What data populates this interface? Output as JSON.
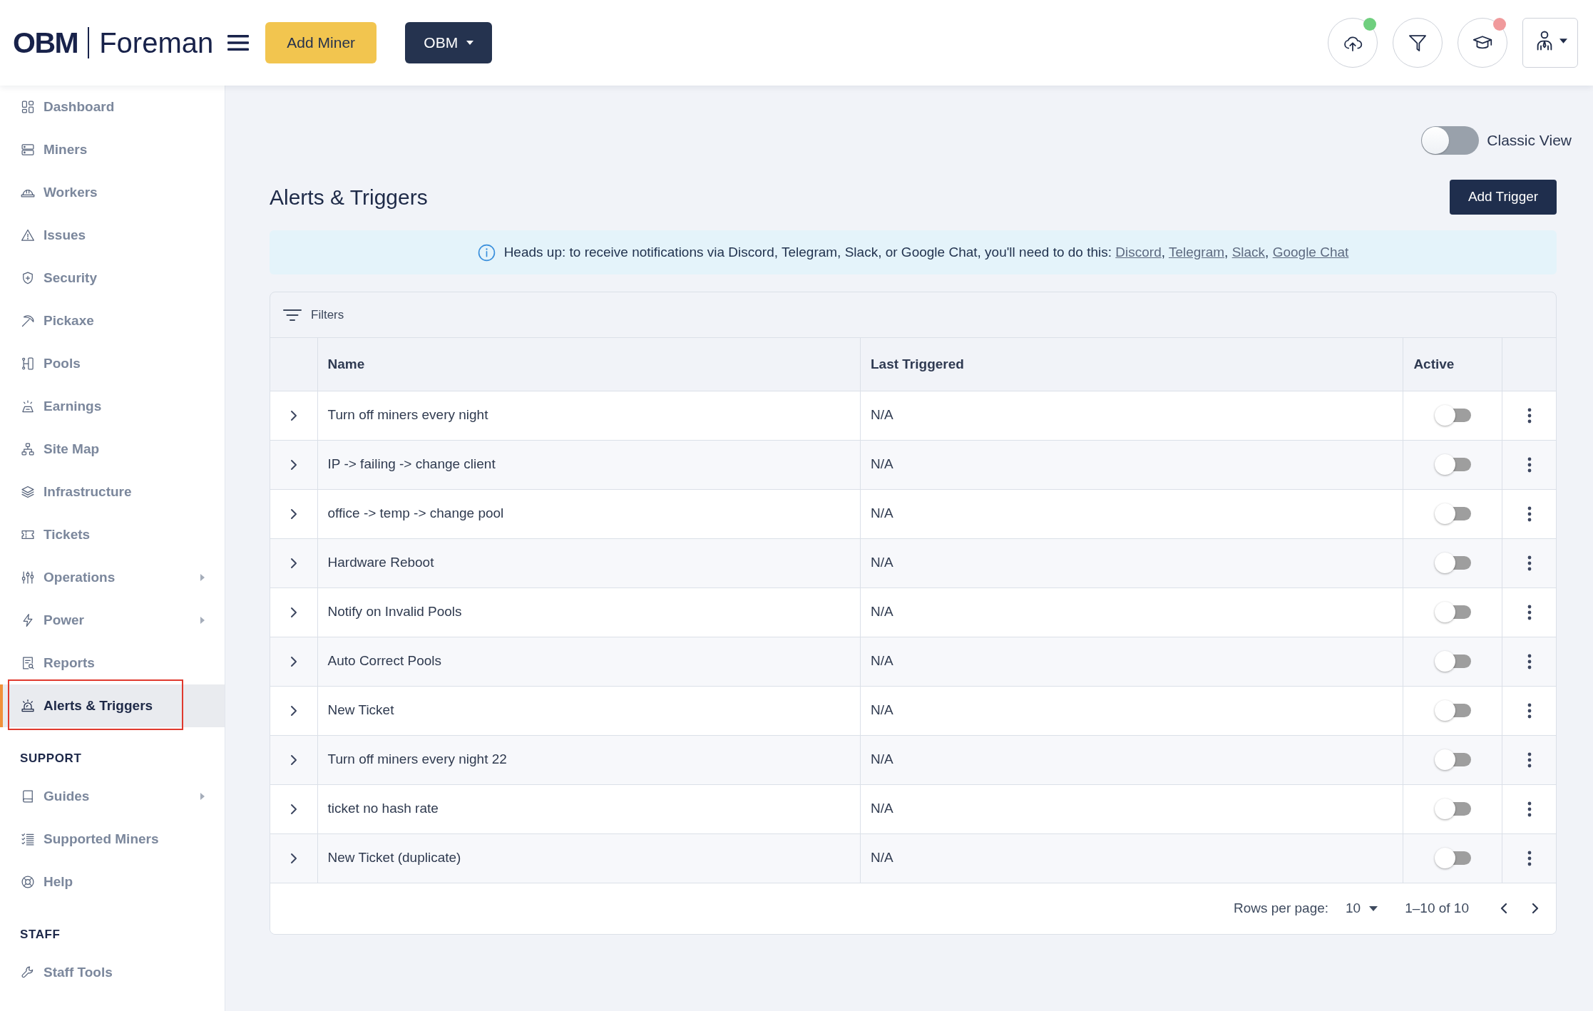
{
  "header": {
    "logo": {
      "brand": "OBM",
      "product": "Foreman"
    },
    "add_button": "Add Miner",
    "org_menu": "OBM",
    "icons": [
      {
        "kind": "round",
        "color": "#6fcf7e"
      },
      {
        "kind": "round"
      },
      {
        "kind": "round",
        "color": "#f09a9c"
      },
      {
        "kind": "square"
      }
    ]
  },
  "sidebar": {
    "sections": [
      {
        "items": [
          {
            "label": "Dashboard",
            "selected": false,
            "expandable": false,
            "highlighted": false
          },
          {
            "label": "Miners",
            "selected": false,
            "expandable": false,
            "highlighted": false
          },
          {
            "label": "Workers",
            "selected": false,
            "expandable": false,
            "highlighted": false
          },
          {
            "label": "Issues",
            "selected": false,
            "expandable": false,
            "highlighted": false
          },
          {
            "label": "Security",
            "selected": false,
            "expandable": false,
            "highlighted": false
          },
          {
            "label": "Pickaxe",
            "selected": false,
            "expandable": false,
            "highlighted": false
          },
          {
            "label": "Pools",
            "selected": false,
            "expandable": false,
            "highlighted": false
          },
          {
            "label": "Earnings",
            "selected": false,
            "expandable": false,
            "highlighted": false
          },
          {
            "label": "Site Map",
            "selected": false,
            "expandable": false,
            "highlighted": false
          },
          {
            "label": "Infrastructure",
            "selected": false,
            "expandable": false,
            "highlighted": false
          },
          {
            "label": "Tickets",
            "selected": false,
            "expandable": false,
            "highlighted": false
          },
          {
            "label": "Operations",
            "selected": false,
            "expandable": true,
            "highlighted": false
          },
          {
            "label": "Power",
            "selected": false,
            "expandable": true,
            "highlighted": false
          },
          {
            "label": "Reports",
            "selected": false,
            "expandable": false,
            "highlighted": false
          },
          {
            "label": "Alerts & Triggers",
            "selected": true,
            "expandable": false,
            "highlighted": true
          }
        ]
      },
      {
        "title": "SUPPORT",
        "items": [
          {
            "label": "Guides",
            "selected": false,
            "expandable": true,
            "highlighted": false
          },
          {
            "label": "Supported Miners",
            "selected": false,
            "expandable": false,
            "highlighted": false
          },
          {
            "label": "Help",
            "selected": false,
            "expandable": false,
            "highlighted": false
          }
        ]
      },
      {
        "title": "STAFF",
        "items": [
          {
            "label": "Staff Tools",
            "selected": false,
            "expandable": false,
            "highlighted": false
          }
        ]
      }
    ]
  },
  "main": {
    "classic_view": {
      "label": "Classic View",
      "on": false
    },
    "title": "Alerts & Triggers",
    "add_button": "Add Trigger",
    "notice": {
      "parts": [
        {
          "kind": "text",
          "text": "Heads up: to receive notifications via Discord, Telegram, Slack, or Google Chat, you'll need to do this:"
        },
        {
          "kind": "link",
          "text": "Discord"
        },
        {
          "kind": "separator",
          "text": ","
        },
        {
          "kind": "link",
          "text": "Telegram"
        },
        {
          "kind": "separator",
          "text": ","
        },
        {
          "kind": "link",
          "text": "Slack"
        },
        {
          "kind": "separator",
          "text": ","
        },
        {
          "kind": "link",
          "text": "Google Chat"
        }
      ]
    },
    "table": {
      "filters_label": "Filters",
      "columns": [
        "Name",
        "Last Triggered",
        "Active"
      ],
      "rows": [
        {
          "name": "Turn off miners every night",
          "last_triggered": "N/A",
          "active": false,
          "expanded": false
        },
        {
          "name": "IP -> failing -> change client",
          "last_triggered": "N/A",
          "active": false,
          "expanded": false
        },
        {
          "name": "office -> temp -> change pool",
          "last_triggered": "N/A",
          "active": false,
          "expanded": false
        },
        {
          "name": "Hardware Reboot",
          "last_triggered": "N/A",
          "active": false,
          "expanded": false
        },
        {
          "name": "Notify on Invalid Pools",
          "last_triggered": "N/A",
          "active": false,
          "expanded": false
        },
        {
          "name": "Auto Correct Pools",
          "last_triggered": "N/A",
          "active": false,
          "expanded": false
        },
        {
          "name": "New Ticket",
          "last_triggered": "N/A",
          "active": false,
          "expanded": false
        },
        {
          "name": "Turn off miners every night 22",
          "last_triggered": "N/A",
          "active": false,
          "expanded": false
        },
        {
          "name": "ticket no hash rate",
          "last_triggered": "N/A",
          "active": false,
          "expanded": false
        },
        {
          "name": "New Ticket (duplicate)",
          "last_triggered": "N/A",
          "active": false,
          "expanded": false
        }
      ],
      "footer": {
        "rows_per_page_label": "Rows per page:",
        "rows_per_page": "10",
        "range": "1–10 of 10"
      }
    }
  }
}
